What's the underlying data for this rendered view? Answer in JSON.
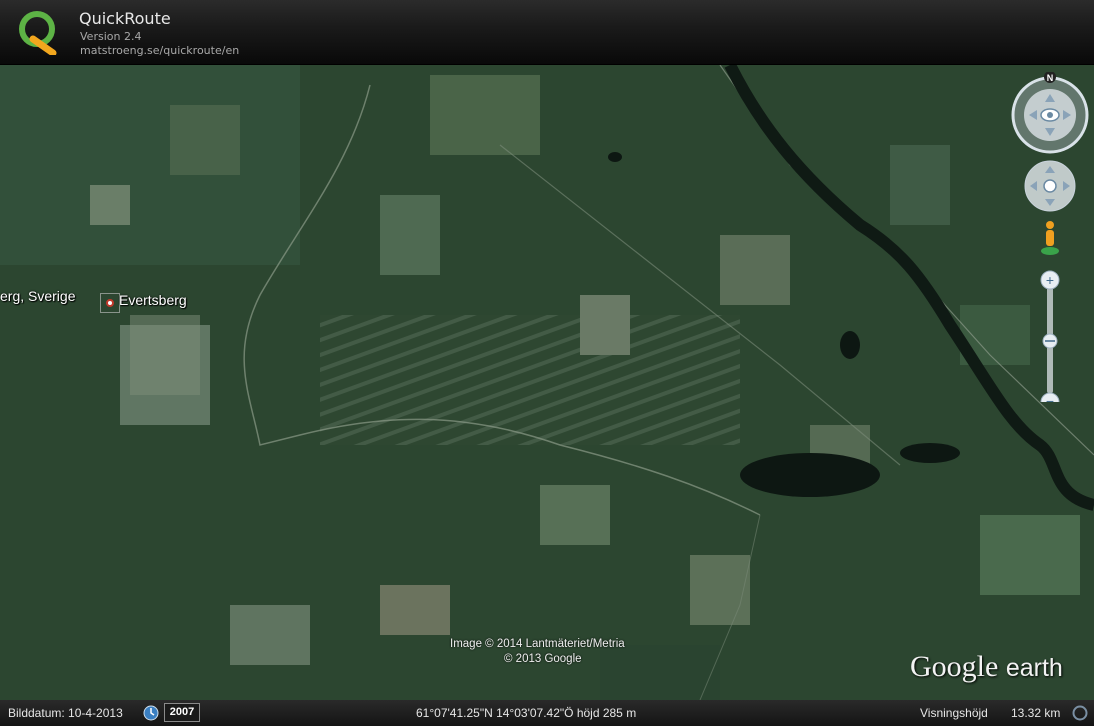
{
  "app": {
    "title": "QuickRoute",
    "version": "Version 2.4",
    "url": "matstroeng.se/quickroute/en"
  },
  "map": {
    "labels": {
      "left_place": "erg, Sverige",
      "place": "Evertsberg"
    },
    "attribution_line1": "Image © 2014 Lantmäteriet/Metria",
    "attribution_line2": "© 2013 Google",
    "brand_google": "Google",
    "brand_earth": "earth"
  },
  "navigation": {
    "compass_north": "N",
    "zoom_in": "+",
    "zoom_out": "−"
  },
  "statusbar": {
    "image_date": "Bilddatum: 10-4-2013",
    "year": "2007",
    "coordinates": "61°07'41.25\"N   14°03'07.42\"Ö  höjd    285 m",
    "eye_alt_label": "Visningshöjd",
    "eye_alt_value": "13.32 km"
  },
  "colors": {
    "forest": "#2c4630",
    "clearing": "#5b7058",
    "water": "#0d1712",
    "header": "#111111"
  }
}
